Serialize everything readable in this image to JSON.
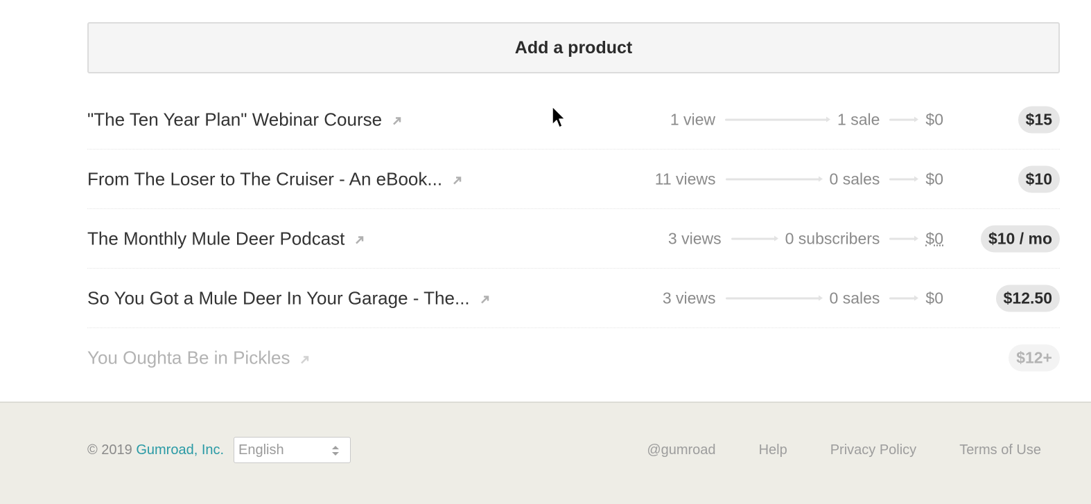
{
  "add_product": {
    "label": "Add a product"
  },
  "products": [
    {
      "title": "\"The Ten Year Plan\" Webinar Course",
      "views": "1 view",
      "conversions": "1 sale",
      "revenue": "$0",
      "price": "$15"
    },
    {
      "title": "From The Loser to The Cruiser - An eBook...",
      "views": "11 views",
      "conversions": "0 sales",
      "revenue": "$0",
      "price": "$10"
    },
    {
      "title": "The Monthly Mule Deer Podcast",
      "views": "3 views",
      "conversions": "0 subscribers",
      "revenue": "$0",
      "price": "$10 / mo"
    },
    {
      "title": "So You Got a Mule Deer In Your Garage - The...",
      "views": "3 views",
      "conversions": "0 sales",
      "revenue": "$0",
      "price": "$12.50"
    },
    {
      "title": "You Oughta Be in Pickles",
      "price": "$12+"
    }
  ],
  "footer": {
    "copyright_prefix": "© 2019 ",
    "company": "Gumroad, Inc.",
    "language": "English",
    "links": [
      "@gumroad",
      "Help",
      "Privacy Policy",
      "Terms of Use"
    ]
  },
  "colors": {
    "accent": "#2a9aa5",
    "footer_bg": "#eeede6",
    "price_badge": "#e6e6e6"
  },
  "icons": {
    "external_link": "arrow-up-right-icon",
    "select": "select-arrows-icon",
    "cursor": "mouse-cursor-icon"
  }
}
